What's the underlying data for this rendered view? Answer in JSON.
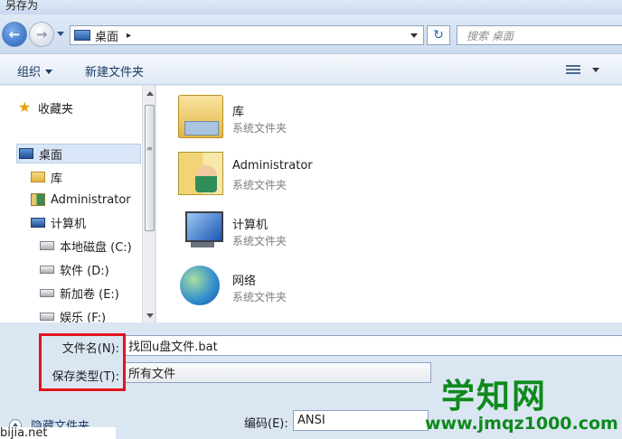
{
  "window": {
    "title": "另存为"
  },
  "address": {
    "location": "桌面",
    "separator": "▸",
    "search_placeholder": "搜索 桌面",
    "refresh_glyph": "↻",
    "back_glyph": "←",
    "forward_glyph": "→"
  },
  "toolbar": {
    "organize": "组织",
    "new_folder": "新建文件夹"
  },
  "nav": {
    "favorites": "收藏夹",
    "desktop": "桌面",
    "libraries": "库",
    "user": "Administrator",
    "computer": "计算机",
    "drives": [
      "本地磁盘 (C:)",
      "软件 (D:)",
      "新加卷 (E:)",
      "娱乐 (F:)"
    ],
    "star_glyph": "★",
    "grip_glyph": "≡"
  },
  "files": [
    {
      "name": "库",
      "type": "系统文件夹",
      "icon": "library-icon"
    },
    {
      "name": "Administrator",
      "type": "系统文件夹",
      "icon": "user-folder-icon"
    },
    {
      "name": "计算机",
      "type": "系统文件夹",
      "icon": "computer-icon"
    },
    {
      "name": "网络",
      "type": "系统文件夹",
      "icon": "network-icon"
    }
  ],
  "form": {
    "filename_label": "文件名(N):",
    "filename_value": "找回u盘文件.bat",
    "filetype_label": "保存类型(T):",
    "filetype_value": "所有文件",
    "hide_folders": "隐藏文件夹",
    "encoding_label": "编码(E):",
    "encoding_value": "ANSI"
  },
  "watermark": {
    "main": "学知网",
    "url": "www.jmqz1000.com",
    "corner": "bijia.net"
  },
  "colors": {
    "highlight_box": "#e2141c",
    "watermark": "#0e8a1c"
  }
}
